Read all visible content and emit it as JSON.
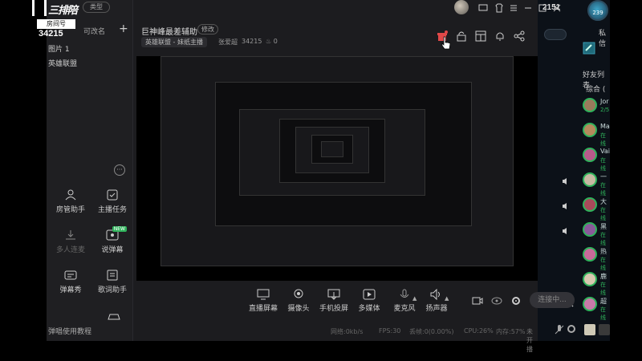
{
  "colors": {
    "accent": "#e04848",
    "online": "#2fb35b",
    "panel": "#1c1c1f",
    "friends_bg": "#0c1118"
  },
  "logo": {
    "text": "三排陪",
    "badge": "房间号",
    "room_id": "34215"
  },
  "top": {
    "type_pill": "类型"
  },
  "scenes": {
    "editable": "可改名",
    "items": [
      "图片 1",
      "英雄联盟"
    ]
  },
  "tools": [
    {
      "label": "房管助手",
      "icon": "user-admin-icon"
    },
    {
      "label": "主播任务",
      "icon": "task-icon"
    },
    {
      "label": "多人连麦",
      "icon": "multi-mic-icon",
      "dim": true
    },
    {
      "label": "说弹幕",
      "icon": "danmaku-voice-icon",
      "badge": "NEW"
    },
    {
      "label": "弹幕秀",
      "icon": "danmaku-show-icon"
    },
    {
      "label": "歌词助手",
      "icon": "lyrics-icon"
    }
  ],
  "tutorial": "弹唱使用教程",
  "header": {
    "title": "巨神峰最差辅助",
    "edit": "修改",
    "category": "英雄联盟 - 妹纸主播",
    "streamer": "张爱超",
    "uid": "34215",
    "hot": "0"
  },
  "bottom_tools": [
    {
      "label": "直播屏幕",
      "icon": "screen-icon"
    },
    {
      "label": "摄像头",
      "icon": "camera-icon"
    },
    {
      "label": "手机投屏",
      "icon": "phone-cast-icon"
    },
    {
      "label": "多媒体",
      "icon": "media-icon"
    },
    {
      "label": "麦克风",
      "icon": "mic-icon"
    },
    {
      "label": "扬声器",
      "icon": "speaker-icon"
    }
  ],
  "live_button": "连接中...",
  "status": {
    "network": "网络:0kb/s",
    "fps": "FPS:30",
    "lost": "丢帧:0(0.00%)",
    "cpu": "CPU:26%",
    "mem": "内存:57%",
    "unopen": "未开播"
  },
  "friends": {
    "count": "2151",
    "level": "239",
    "private": "私信",
    "list_title": "好友列表",
    "group": "综合 (",
    "items": [
      {
        "name": "Jor",
        "status": "2/5",
        "color": "#9a7a5b"
      },
      {
        "name": "Ma",
        "status": "在线",
        "color": "#b58a5c"
      },
      {
        "name": "Vai",
        "status": "在线",
        "color": "#b85a8a"
      },
      {
        "name": "一",
        "status": "在线",
        "color": "#c8b8a2"
      },
      {
        "name": "大",
        "status": "在线",
        "color": "#a84a5a"
      },
      {
        "name": "黑",
        "status": "在线",
        "color": "#8a5a9a"
      },
      {
        "name": "热",
        "status": "在线",
        "color": "#c86a9a"
      },
      {
        "name": "鹿",
        "status": "在线",
        "color": "#d8c8b0"
      },
      {
        "name": "超",
        "status": "在线",
        "color": "#c87aa8"
      }
    ]
  }
}
